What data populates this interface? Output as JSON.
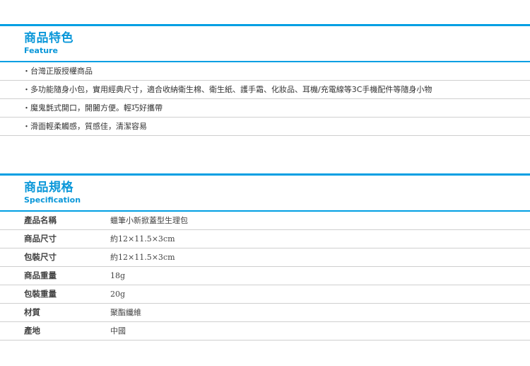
{
  "feature": {
    "title_zh": "商品特色",
    "title_en": "Feature",
    "items": [
      "・台灣正版授權商品",
      "・多功能隨身小包，實用經典尺寸，適合收納衛生棉、衛生紙、護手霜、化妝品、耳機/充電線等3C手機配件等隨身小物",
      "・魔鬼氈式開口，開闔方便。輕巧好攜帶",
      "・滑面輕柔觸感，質感佳，清潔容易"
    ]
  },
  "spec": {
    "title_zh": "商品規格",
    "title_en": "Specification",
    "rows": [
      {
        "label": "產品名稱",
        "value": "蠟筆小新掀蓋型生理包"
      },
      {
        "label": "商品尺寸",
        "value": "約12×11.5×3cm"
      },
      {
        "label": "包裝尺寸",
        "value": "約12×11.5×3cm"
      },
      {
        "label": "商品重量",
        "value": "18g"
      },
      {
        "label": "包裝重量",
        "value": "20g"
      },
      {
        "label": "材質",
        "value": "聚酯纖維"
      },
      {
        "label": "產地",
        "value": "中國"
      }
    ]
  },
  "colors": {
    "accent": "#009fe3",
    "divider": "#cfcfcf"
  }
}
